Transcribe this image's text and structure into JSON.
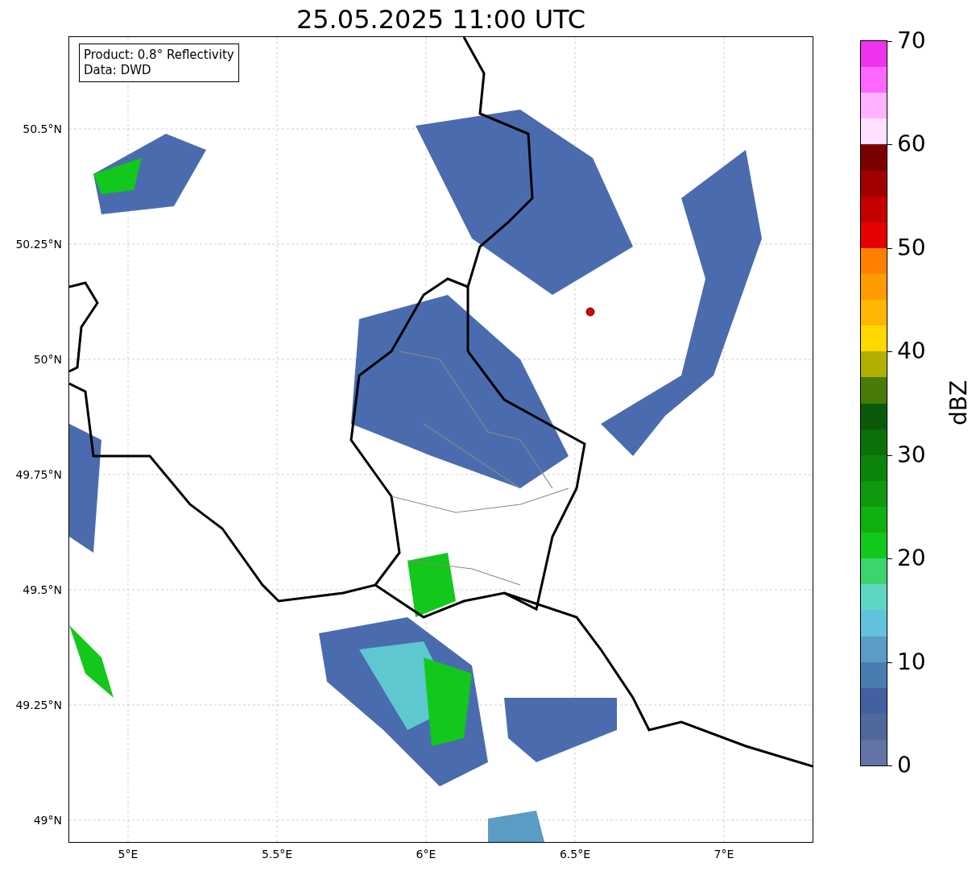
{
  "title": "25.05.2025 11:00 UTC",
  "legend": [
    "Product: 0.8° Reflectivity",
    "Data: DWD"
  ],
  "map": {
    "x_ticks": [
      "5°E",
      "5.5°E",
      "6°E",
      "6.5°E",
      "7°E"
    ],
    "y_ticks": [
      "50.5°N",
      "50.25°N",
      "50°N",
      "49.75°N",
      "49.5°N",
      "49.25°N",
      "49°N"
    ]
  },
  "colorbar": {
    "label": "dBZ",
    "ticks": [
      "70",
      "60",
      "50",
      "40",
      "30",
      "20",
      "10",
      "0"
    ],
    "bins": [
      {
        "color": "#ee33ee"
      },
      {
        "color": "#ff66ff"
      },
      {
        "color": "#ffb3ff"
      },
      {
        "color": "#ffe0ff"
      },
      {
        "color": "#7a0000"
      },
      {
        "color": "#a00000"
      },
      {
        "color": "#c40000"
      },
      {
        "color": "#e60000"
      },
      {
        "color": "#ff8000"
      },
      {
        "color": "#ff9b00"
      },
      {
        "color": "#ffb600"
      },
      {
        "color": "#ffd800"
      },
      {
        "color": "#b0b000"
      },
      {
        "color": "#4a7a0a"
      },
      {
        "color": "#0a5a0a"
      },
      {
        "color": "#0a700a"
      },
      {
        "color": "#0c840c"
      },
      {
        "color": "#0e9a0e"
      },
      {
        "color": "#10b010"
      },
      {
        "color": "#12c81a"
      },
      {
        "color": "#3cd46c"
      },
      {
        "color": "#5ed6c4"
      },
      {
        "color": "#62c2dc"
      },
      {
        "color": "#5a9cc4"
      },
      {
        "color": "#4a7cb2"
      },
      {
        "color": "#4260a2"
      },
      {
        "color": "#50689c"
      },
      {
        "color": "#6274a6"
      }
    ]
  }
}
